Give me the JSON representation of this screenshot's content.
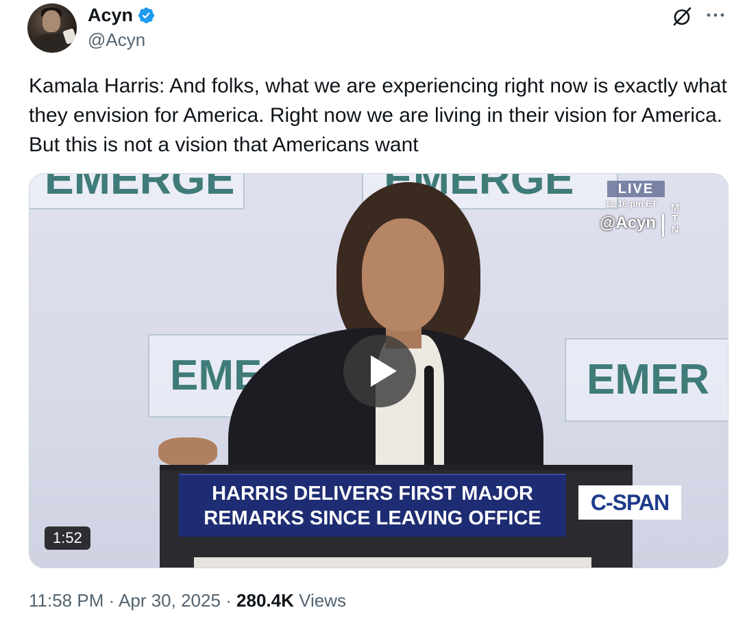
{
  "author": {
    "display_name": "Acyn",
    "handle": "@Acyn",
    "verified": true,
    "verified_color": "#1d9bf0"
  },
  "header_icons": {
    "grok": "grok-icon",
    "more": "more-options-icon"
  },
  "tweet": {
    "text": "Kamala Harris: And folks, what we are experiencing right now is exactly what they envision for America. Right now we are living in their vision for America. But this is not a vision that Americans want"
  },
  "media": {
    "type": "video",
    "duration": "1:52",
    "live_label": "LIVE",
    "live_time": "11:16 pm ET",
    "watermark": "@Acyn",
    "watermark_mark": [
      "M",
      "T",
      "N"
    ],
    "banner_text_top": "EMERGE",
    "banner_text_mid_left": "EME",
    "banner_text_mid_right": "EMER",
    "lower_third_line1": "HARRIS DELIVERS FIRST MAJOR",
    "lower_third_line2": "REMARKS SINCE LEAVING OFFICE",
    "network_logo": "C-SPAN"
  },
  "meta": {
    "time": "11:58 PM",
    "separator": " · ",
    "date": "Apr 30, 2025",
    "views_count": "280.4K",
    "views_label": "Views"
  }
}
